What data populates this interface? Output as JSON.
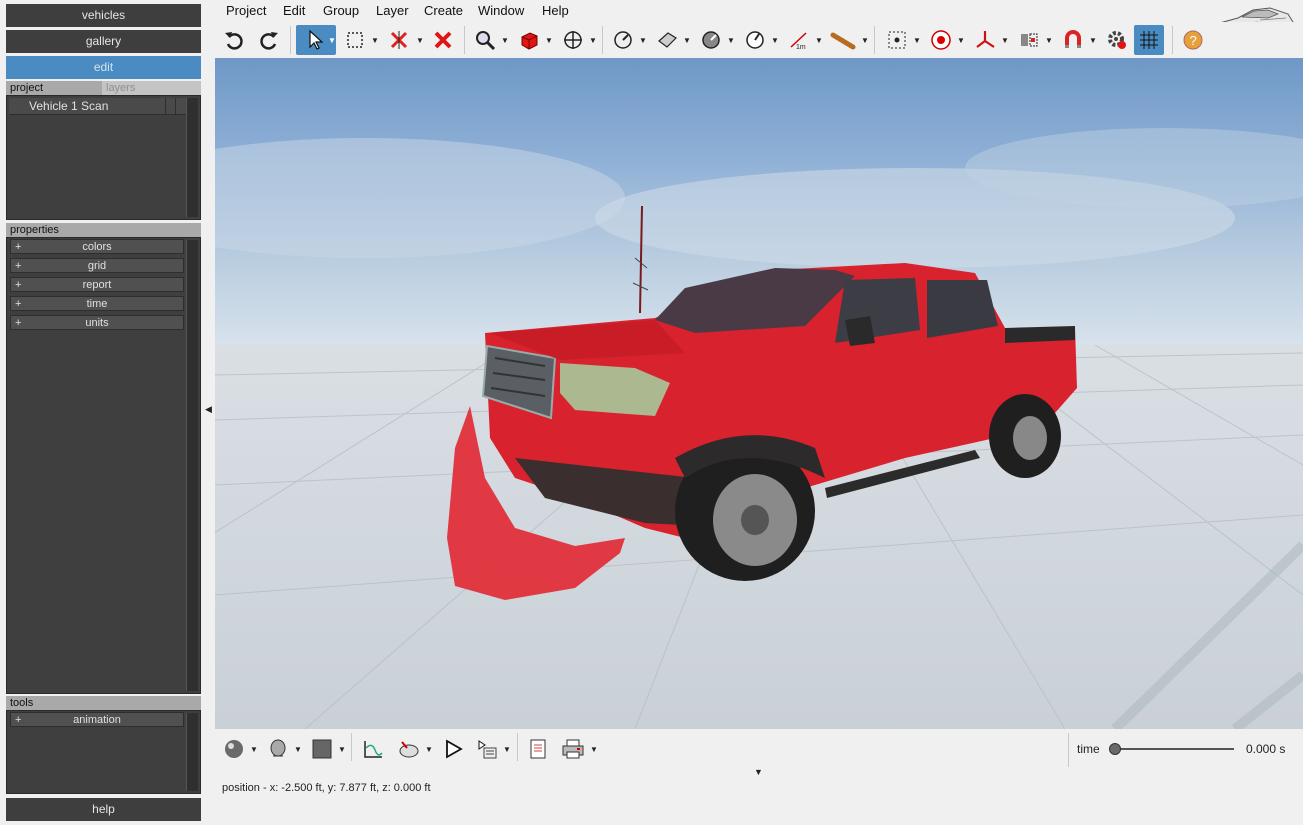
{
  "sidebar": {
    "nav": [
      {
        "label": "vehicles"
      },
      {
        "label": "gallery"
      },
      {
        "label": "edit"
      }
    ],
    "tabs": [
      {
        "label": "project"
      },
      {
        "label": "layers"
      }
    ],
    "project_items": [
      {
        "label": "Vehicle 1 Scan"
      }
    ],
    "properties_header": "properties",
    "properties": [
      {
        "label": "colors"
      },
      {
        "label": "grid"
      },
      {
        "label": "report"
      },
      {
        "label": "time"
      },
      {
        "label": "units"
      }
    ],
    "tools_header": "tools",
    "tools": [
      {
        "label": "animation"
      }
    ],
    "help_label": "help",
    "expand_glyph": "+"
  },
  "menu": {
    "items": [
      "Project",
      "Edit",
      "Group",
      "Layer",
      "Create",
      "Window",
      "Help"
    ]
  },
  "toolbar": {
    "icons": [
      "undo-icon",
      "redo-icon",
      "select-arrow-icon",
      "select-box-icon",
      "delete-marker-icon",
      "delete-icon",
      "zoom-icon",
      "cube-icon",
      "move-icon",
      "measure-dial-icon",
      "plane-icon",
      "measure-dial-2-icon",
      "angle-dial-icon",
      "scale-1m-icon",
      "pipe-icon",
      "target-box-icon",
      "record-icon",
      "axis-icon",
      "mirror-icon",
      "magnet-icon",
      "settings-icon",
      "grid-icon",
      "help-icon"
    ],
    "scale_label": "1m"
  },
  "bottom": {
    "time_label": "time",
    "time_value": "0.000 s",
    "time_progress": 0.0,
    "position_text": "position - x: -2.500 ft, y: 7.877 ft, z: 0.000 ft"
  },
  "colors": {
    "accent": "#4a8cc2",
    "panel_dark": "#3f3f3f",
    "truck_red": "#d8222e"
  }
}
